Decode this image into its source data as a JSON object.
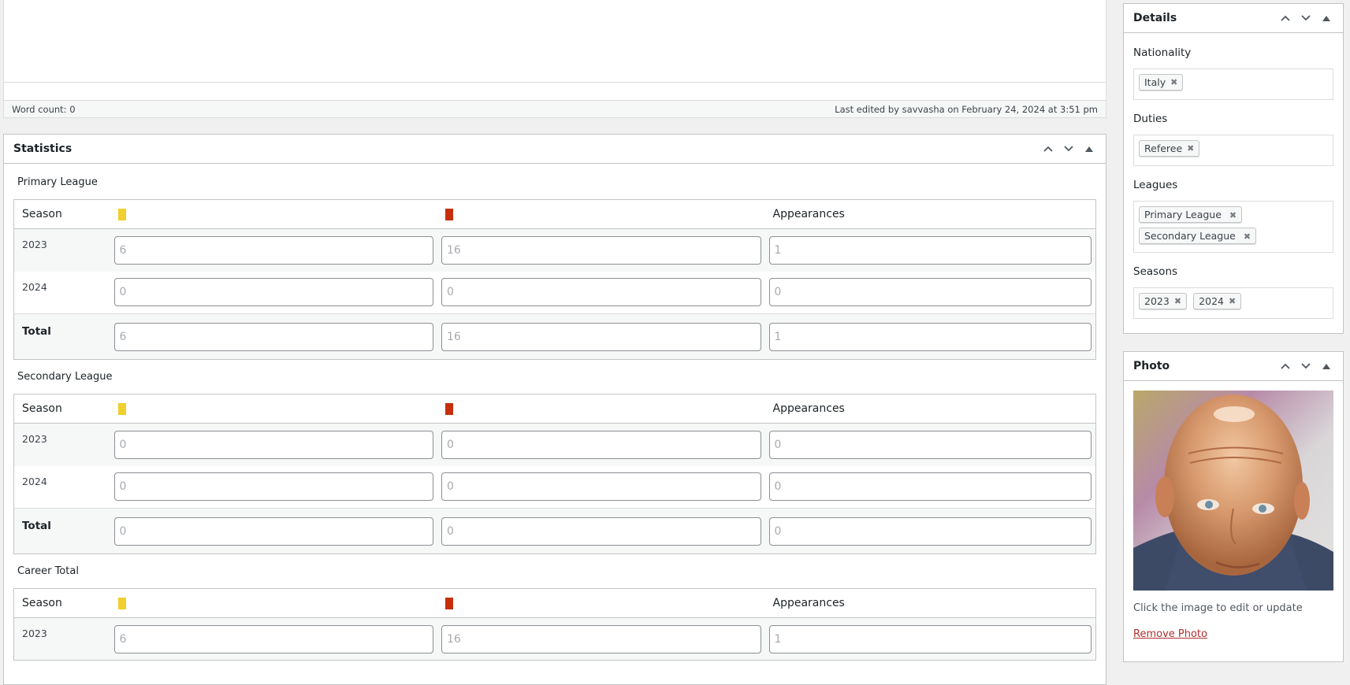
{
  "editor": {
    "word_count": "Word count: 0",
    "last_edited": "Last edited by savvasha on February 24, 2024 at 3:51 pm"
  },
  "statistics": {
    "title": "Statistics",
    "columns": {
      "season": "Season",
      "yellow_card": "yellow-card-icon",
      "red_card": "red-card-icon",
      "appearances": "Appearances"
    },
    "colors": {
      "yellow_card": "#f0cf2e",
      "red_card": "#c62f0b"
    },
    "leagues": [
      {
        "name": "Primary League",
        "rows": [
          {
            "season": "2023",
            "yellow": "6",
            "red": "16",
            "appearances": "1"
          },
          {
            "season": "2024",
            "yellow": "0",
            "red": "0",
            "appearances": "0"
          }
        ],
        "total": {
          "season": "Total",
          "yellow": "6",
          "red": "16",
          "appearances": "1"
        }
      },
      {
        "name": "Secondary League",
        "rows": [
          {
            "season": "2023",
            "yellow": "0",
            "red": "0",
            "appearances": "0"
          },
          {
            "season": "2024",
            "yellow": "0",
            "red": "0",
            "appearances": "0"
          }
        ],
        "total": {
          "season": "Total",
          "yellow": "0",
          "red": "0",
          "appearances": "0"
        }
      },
      {
        "name": "Career Total",
        "rows": [
          {
            "season": "2023",
            "yellow": "6",
            "red": "16",
            "appearances": "1"
          }
        ]
      }
    ]
  },
  "details": {
    "title": "Details",
    "nationality": {
      "label": "Nationality",
      "values": [
        "Italy"
      ]
    },
    "duties": {
      "label": "Duties",
      "values": [
        "Referee"
      ]
    },
    "leagues": {
      "label": "Leagues",
      "values": [
        "Primary League",
        "Secondary League"
      ]
    },
    "seasons": {
      "label": "Seasons",
      "values": [
        "2023",
        "2024"
      ]
    }
  },
  "photo": {
    "title": "Photo",
    "hint": "Click the image to edit or update",
    "remove_label": "Remove Photo"
  },
  "chip_remove_glyph": "✖"
}
